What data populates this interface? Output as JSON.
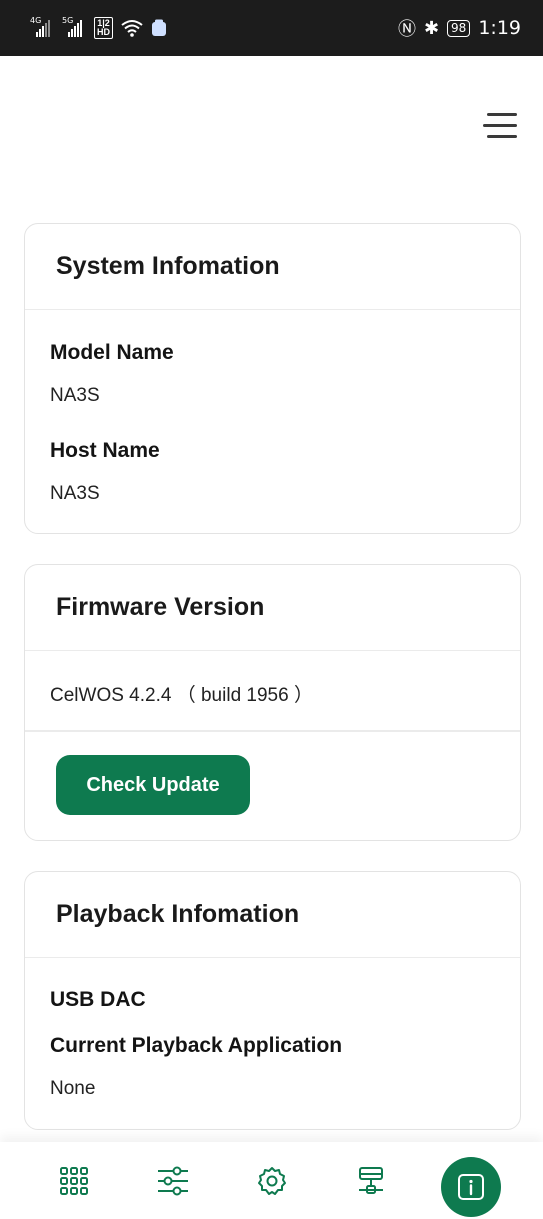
{
  "status_bar": {
    "net1": "4G",
    "net2": "5G",
    "hd_top": "1|2",
    "hd_bottom": "HD",
    "battery": "98",
    "time": "1:19"
  },
  "cards": {
    "system": {
      "title": "System Infomation",
      "model_label": "Model Name",
      "model_value": "NA3S",
      "host_label": "Host Name",
      "host_value": "NA3S"
    },
    "firmware": {
      "title": "Firmware Version",
      "version": "CelWOS 4.2.4 （ build 1956 ）",
      "update_button": "Check Update"
    },
    "playback": {
      "title": "Playback Infomation",
      "source_label": "USB DAC",
      "app_label": "Current Playback Application",
      "app_value": "None"
    }
  },
  "nav": {
    "items": [
      "grid-icon",
      "sliders-icon",
      "gear-icon",
      "network-icon",
      "info-icon"
    ],
    "active_index": 4
  },
  "colors": {
    "accent": "#0e7a4f",
    "status_bar_bg": "#1c1c1c"
  }
}
